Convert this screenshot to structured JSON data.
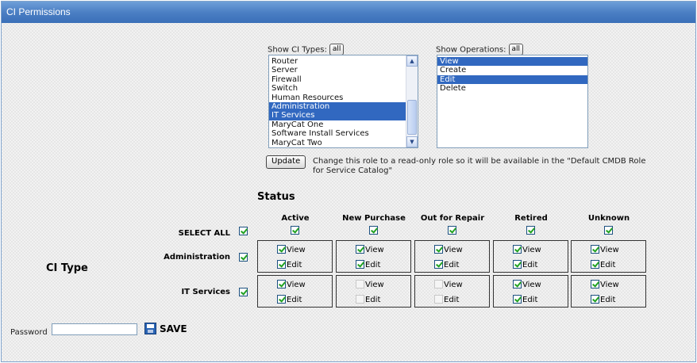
{
  "window": {
    "title": "CI Permissions"
  },
  "ci_types": {
    "label": "Show CI Types:",
    "all_label": "all",
    "options": [
      {
        "label": "Router",
        "selected": false
      },
      {
        "label": "Server",
        "selected": false
      },
      {
        "label": "Firewall",
        "selected": false
      },
      {
        "label": "Switch",
        "selected": false
      },
      {
        "label": "Human Resources",
        "selected": false
      },
      {
        "label": "Administration",
        "selected": true
      },
      {
        "label": "IT Services",
        "selected": true
      },
      {
        "label": "MaryCat One",
        "selected": false
      },
      {
        "label": "Software Install Services",
        "selected": false
      },
      {
        "label": "MaryCat Two",
        "selected": false
      }
    ]
  },
  "operations": {
    "label": "Show Operations:",
    "all_label": "all",
    "options": [
      {
        "label": "View",
        "selected": true
      },
      {
        "label": "Create",
        "selected": false
      },
      {
        "label": "Edit",
        "selected": true
      },
      {
        "label": "Delete",
        "selected": false
      }
    ]
  },
  "update": {
    "button_label": "Update",
    "note_line1": "Change this role to a read-only role so it will be available in the \"Default CMDB Role",
    "note_line2": "for Service Catalog\""
  },
  "matrix": {
    "status_heading": "Status",
    "ci_type_heading": "CI Type",
    "select_all_label": "SELECT ALL",
    "columns": [
      "Active",
      "New Purchase",
      "Out for Repair",
      "Retired",
      "Unknown"
    ],
    "select_all_checks": [
      true,
      true,
      true,
      true,
      true
    ],
    "select_all_row_check": true,
    "view_label": "View",
    "edit_label": "Edit",
    "rows": [
      {
        "label": "Administration",
        "row_check": true,
        "cells": [
          {
            "view": true,
            "edit": true
          },
          {
            "view": true,
            "edit": true
          },
          {
            "view": true,
            "edit": true
          },
          {
            "view": true,
            "edit": true
          },
          {
            "view": true,
            "edit": true
          }
        ]
      },
      {
        "label": "IT Services",
        "row_check": true,
        "cells": [
          {
            "view": true,
            "edit": true
          },
          {
            "view": false,
            "edit": false
          },
          {
            "view": false,
            "edit": false
          },
          {
            "view": true,
            "edit": true
          },
          {
            "view": true,
            "edit": true
          }
        ]
      }
    ]
  },
  "footer": {
    "password_label": "Password",
    "password_value": "",
    "save_label": "SAVE"
  },
  "icons": {
    "save": "floppy-disk-icon",
    "check": "checkmark-icon"
  },
  "colors": {
    "title_bar": "#4b7fc4",
    "selection": "#3168c0",
    "check": "#21a121"
  }
}
